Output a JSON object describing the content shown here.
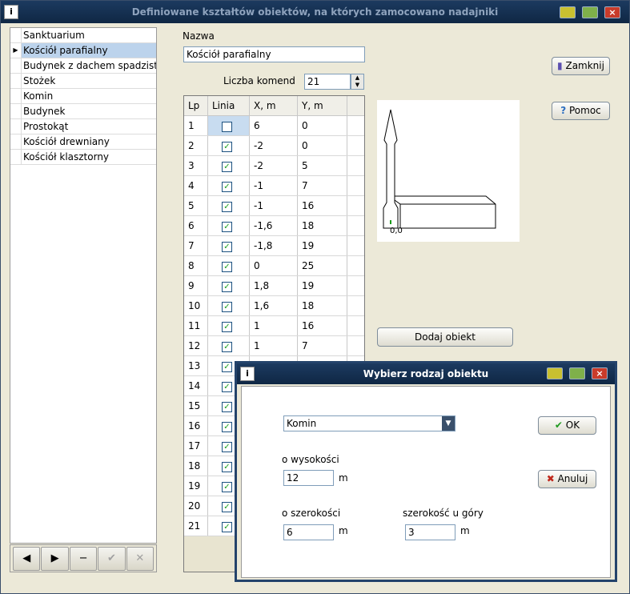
{
  "window": {
    "title": "Definiowane kształtów obiektów, na których zamocowano nadajniki"
  },
  "objects_list": [
    "Sanktuarium",
    "Kościół parafialny",
    "Budynek z dachem spadzistym",
    "Stożek",
    "Komin",
    "Budynek",
    "Prostokąt",
    "Kościół drewniany",
    "Kościół klasztorny"
  ],
  "selected_index": 1,
  "nav": {
    "prev": "◀",
    "next": "▶",
    "delete": "−",
    "confirm": "✔",
    "cancel": "✕"
  },
  "form": {
    "name_label": "Nazwa",
    "name_value": "Kościół parafialny",
    "count_label": "Liczba komend",
    "count_value": "21"
  },
  "grid": {
    "headers": [
      "Lp",
      "Linia",
      "X, m",
      "Y, m"
    ],
    "rows": [
      {
        "lp": "1",
        "line": false,
        "x": "6",
        "y": "0"
      },
      {
        "lp": "2",
        "line": true,
        "x": "-2",
        "y": "0"
      },
      {
        "lp": "3",
        "line": true,
        "x": "-2",
        "y": "5"
      },
      {
        "lp": "4",
        "line": true,
        "x": "-1",
        "y": "7"
      },
      {
        "lp": "5",
        "line": true,
        "x": "-1",
        "y": "16"
      },
      {
        "lp": "6",
        "line": true,
        "x": "-1,6",
        "y": "18"
      },
      {
        "lp": "7",
        "line": true,
        "x": "-1,8",
        "y": "19"
      },
      {
        "lp": "8",
        "line": true,
        "x": "0",
        "y": "25"
      },
      {
        "lp": "9",
        "line": true,
        "x": "1,8",
        "y": "19"
      },
      {
        "lp": "10",
        "line": true,
        "x": "1,6",
        "y": "18"
      },
      {
        "lp": "11",
        "line": true,
        "x": "1",
        "y": "16"
      },
      {
        "lp": "12",
        "line": true,
        "x": "1",
        "y": "7"
      },
      {
        "lp": "13",
        "line": true,
        "x": "",
        "y": ""
      },
      {
        "lp": "14",
        "line": true,
        "x": "",
        "y": ""
      },
      {
        "lp": "15",
        "line": true,
        "x": "",
        "y": ""
      },
      {
        "lp": "16",
        "line": true,
        "x": "",
        "y": ""
      },
      {
        "lp": "17",
        "line": true,
        "x": "",
        "y": ""
      },
      {
        "lp": "18",
        "line": true,
        "x": "",
        "y": ""
      },
      {
        "lp": "19",
        "line": true,
        "x": "",
        "y": ""
      },
      {
        "lp": "20",
        "line": true,
        "x": "",
        "y": ""
      },
      {
        "lp": "21",
        "line": true,
        "x": "",
        "y": ""
      }
    ]
  },
  "buttons": {
    "close": "Zamknij",
    "help": "Pomoc",
    "add_object": "Dodaj obiekt"
  },
  "preview": {
    "origin_label": "0,0"
  },
  "dialog": {
    "title": "Wybierz rodzaj obiektu",
    "type_value": "Komin",
    "height_label": "o wysokości",
    "height_value": "12",
    "height_unit": "m",
    "width_label": "o szerokości",
    "width_value": "6",
    "width_unit": "m",
    "top_width_label": "szerokość u góry",
    "top_width_value": "3",
    "top_width_unit": "m",
    "ok": "OK",
    "cancel": "Anuluj"
  }
}
